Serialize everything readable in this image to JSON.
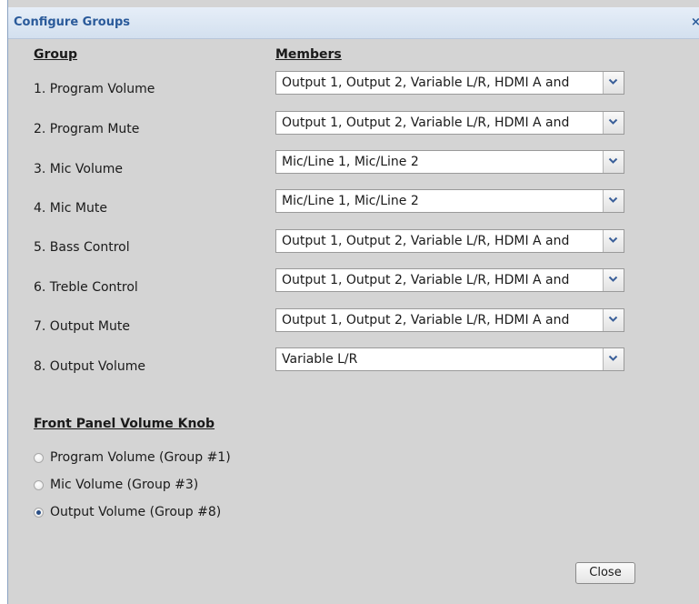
{
  "dialog": {
    "title": "Configure Groups",
    "close_glyph": "×",
    "close_button_label": "Close"
  },
  "headers": {
    "group": "Group",
    "members": "Members",
    "front_panel": "Front Panel Volume Knob"
  },
  "groups": [
    {
      "label": "1. Program Volume",
      "members": "Output 1, Output 2, Variable L/R, HDMI A and"
    },
    {
      "label": "2. Program Mute",
      "members": "Output 1, Output 2, Variable L/R, HDMI A and"
    },
    {
      "label": "3. Mic Volume",
      "members": "Mic/Line 1, Mic/Line 2"
    },
    {
      "label": "4. Mic Mute",
      "members": "Mic/Line 1, Mic/Line 2"
    },
    {
      "label": "5. Bass Control",
      "members": "Output 1, Output 2, Variable L/R, HDMI A and"
    },
    {
      "label": "6. Treble Control",
      "members": "Output 1, Output 2, Variable L/R, HDMI A and"
    },
    {
      "label": "7. Output Mute",
      "members": "Output 1, Output 2, Variable L/R, HDMI A and"
    },
    {
      "label": "8. Output Volume",
      "members": "Variable L/R"
    }
  ],
  "knob_options": [
    {
      "label": "Program Volume (Group #1)",
      "checked": false
    },
    {
      "label": "Mic Volume (Group #3)",
      "checked": false
    },
    {
      "label": "Output Volume (Group #8)",
      "checked": true
    }
  ],
  "icons": {
    "dropdown": "chevron-down-icon",
    "close": "close-icon"
  },
  "colors": {
    "title_text": "#2a5a9a",
    "dialog_background": "#d4d4d4",
    "radio_selected": "#2a4f86"
  }
}
